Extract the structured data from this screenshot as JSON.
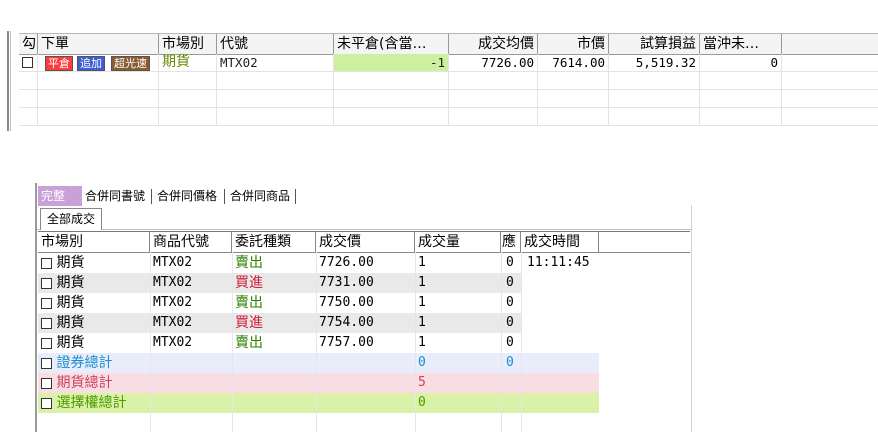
{
  "positions": {
    "columns": [
      "勾",
      "下單",
      "市場別",
      "代號",
      "未平倉(含當…",
      "成交均價",
      "市價",
      "試算損益",
      "當沖未…"
    ],
    "row": {
      "buttons": [
        "平倉",
        "追加",
        "超光速"
      ],
      "market": "期貨",
      "code": "MTX02",
      "open_position": "-1",
      "avg_price": "7726.00",
      "market_price": "7614.00",
      "est_pnl": "5,519.32",
      "daytrade": "0"
    }
  },
  "fills": {
    "tabs": [
      "完整",
      "合併同書號",
      "合併同價格",
      "合併同商品"
    ],
    "subtab": "全部成交",
    "columns": [
      "市場別",
      "商品代號",
      "委託種類",
      "成交價",
      "成交量",
      "應",
      "成交時間"
    ],
    "rows": [
      {
        "market": "期貨",
        "code": "MTX02",
        "type": "賣出",
        "price": "7726.00",
        "qty": "1",
        "x": "0",
        "time": "11:11:45"
      },
      {
        "market": "期貨",
        "code": "MTX02",
        "type": "買進",
        "price": "7731.00",
        "qty": "1",
        "x": "0",
        "time": ""
      },
      {
        "market": "期貨",
        "code": "MTX02",
        "type": "賣出",
        "price": "7750.00",
        "qty": "1",
        "x": "0",
        "time": ""
      },
      {
        "market": "期貨",
        "code": "MTX02",
        "type": "買進",
        "price": "7754.00",
        "qty": "1",
        "x": "0",
        "time": ""
      },
      {
        "market": "期貨",
        "code": "MTX02",
        "type": "賣出",
        "price": "7757.00",
        "qty": "1",
        "x": "0",
        "time": ""
      }
    ],
    "totals": [
      {
        "label": "證券總計",
        "qty": "0",
        "x": "0"
      },
      {
        "label": "期貨總計",
        "qty": "5",
        "x": ""
      },
      {
        "label": "選擇權總計",
        "qty": "0",
        "x": ""
      }
    ]
  },
  "colors": {
    "sell": "#2a7f00",
    "buy": "#d0203a",
    "position_cell": "#ccefa0",
    "securities_total": "#e8ecfb",
    "futures_total": "#f8dde3",
    "options_total": "#d9f2a8"
  }
}
